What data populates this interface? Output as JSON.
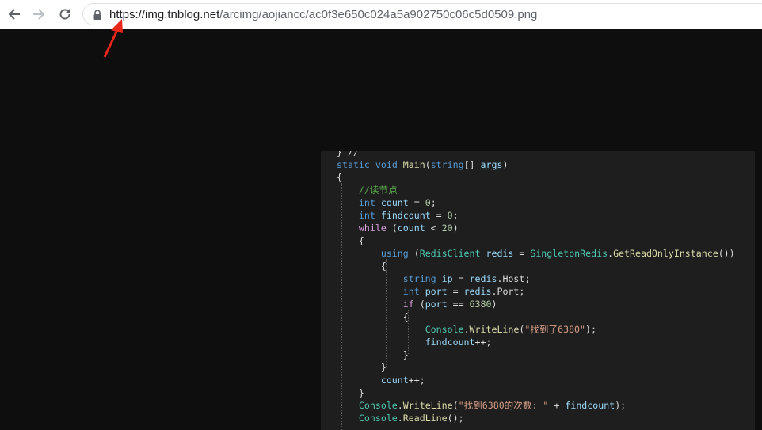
{
  "browser": {
    "url_host": "https://img.tnblog.net",
    "url_path": "/arcimg/aojiancc/ac0f3e650c024a5a902750c06c5d0509.png"
  },
  "code": {
    "partial_top": "} // ",
    "l1": {
      "kw1": "static",
      "kw2": "void",
      "fn": "Main",
      "p1": "(",
      "ty": "string",
      "p2": "[] ",
      "arg": "args",
      "p3": ")"
    },
    "l2": "{",
    "l3": "//读节点",
    "l4": {
      "kw": "int",
      "id": "count",
      "op": " = ",
      "num": "0",
      "end": ";"
    },
    "l5": {
      "kw": "int",
      "id": "findcount",
      "op": " = ",
      "num": "0",
      "end": ";"
    },
    "l6": {
      "kw": "while",
      "p1": " (",
      "id": "count",
      "op": " < ",
      "num": "20",
      "p2": ")"
    },
    "l7": "{",
    "l8": {
      "kw": "using",
      "p1": " (",
      "ty1": "RedisClient",
      "id": "redis",
      "op": " = ",
      "ty2": "SingletonRedis",
      "dot": ".",
      "fn": "GetReadOnlyInstance",
      "p2": "())"
    },
    "l9": "{",
    "l10": {
      "kw": "string",
      "id": "ip",
      "op": " = ",
      "obj": "redis",
      "dot": ".",
      "prop": "Host",
      "end": ";"
    },
    "l11": {
      "kw": "int",
      "id": "port",
      "op": " = ",
      "obj": "redis",
      "dot": ".",
      "prop": "Port",
      "end": ";"
    },
    "l12": {
      "kw": "if",
      "p1": " (",
      "id": "port",
      "op": " == ",
      "num": "6380",
      "p2": ")"
    },
    "l13": "{",
    "l14": {
      "ty": "Console",
      "dot": ".",
      "fn": "WriteLine",
      "p1": "(",
      "str": "\"找到了6380\"",
      "p2": ");"
    },
    "l15": {
      "id": "findcount",
      "op": "++;"
    },
    "l16": "}",
    "l17": "}",
    "l18": {
      "id": "count",
      "op": "++;"
    },
    "l19": "}",
    "l20": {
      "ty": "Console",
      "dot": ".",
      "fn": "WriteLine",
      "p1": "(",
      "str": "\"找到6380的次数: \"",
      "op": " + ",
      "id": "findcount",
      "p2": ");"
    },
    "l21": {
      "ty": "Console",
      "dot": ".",
      "fn": "ReadLine",
      "p1": "();"
    }
  },
  "colors": {
    "keyword": "#569cd6",
    "type": "#4ec9b0",
    "method": "#dcdcaa",
    "identifier": "#9cdcfe",
    "number": "#b5cea8",
    "string": "#d69d85",
    "comment": "#57a64a",
    "control_keyword": "#d8a0df",
    "annotation_arrow": "#e8261b"
  },
  "icons": [
    "back-arrow-icon",
    "forward-arrow-icon",
    "reload-icon",
    "lock-icon",
    "red-pointer-arrow-icon"
  ]
}
